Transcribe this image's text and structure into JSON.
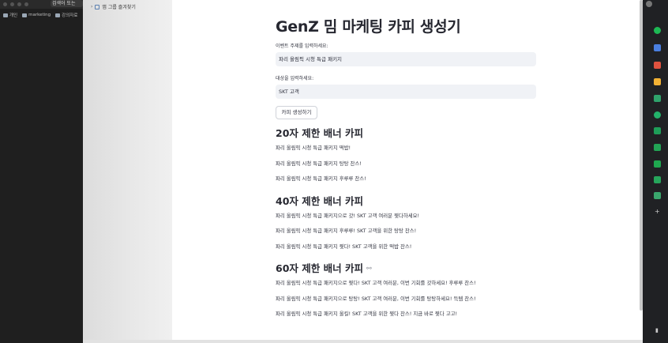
{
  "browser": {
    "search_label": "검색어 또는",
    "bookmarks": [
      "개인",
      "marketing",
      "강의자료"
    ]
  },
  "sidebar": {
    "link_label": "앱 그룹 즐겨찾기"
  },
  "app": {
    "title": "GenZ 밈 마케팅 카피 생성기",
    "event_label": "이벤트 주제를 입력하세요:",
    "event_value": "파리 올림픽 시청 특급 패키지",
    "target_label": "대상을 입력하세요:",
    "target_value": "SKT 고객",
    "generate_button": "카피 생성하기"
  },
  "sections": [
    {
      "heading": "20자 제한 배너 카피",
      "lines": [
        "파리 올림픽 시청 특급 패키지 떡밥!",
        "파리 올림픽 시청 특급 패키지 탕탕 찬스!",
        "파리 올림픽 시청 특급 패키지 후루루 찬스!"
      ]
    },
    {
      "heading": "40자 제한 배너 카피",
      "lines": [
        "파리 올림픽 시청 특급 패키지으로 갓! SKT 고객 여러분 찢다하세요!",
        "파리 올림픽 시청 특급 패키지 후루루! SKT 고객을 위한 탕탕 찬스!",
        "파리 올림픽 시청 특급 패키지 찢다! SKT 고객을 위한 떡밥 찬스!"
      ]
    },
    {
      "heading": "60자 제한 배너 카피",
      "lines": [
        "파리 올림픽 시청 특급 패키지으로 찢다! SKT 고객 여러분, 이번 기회를 갓하세요! 후루루 찬스!",
        "파리 올림픽 시청 특급 패키지으로 탕탕! SKT 고객 여러분, 이번 기회를 탕탕하세요! 득템 찬스!",
        "파리 올림픽 시청 특급 패키지 올킬! SKT 고객을 위한 찢다 찬스! 지금 바로 찢다 고고!"
      ]
    }
  ],
  "icons": {
    "anchor": "link-icon",
    "right_panel": [
      "chrome-green",
      "blue-square",
      "red-square",
      "yellow-square",
      "green-puzzle",
      "green-circle",
      "green-chat",
      "green-sheet",
      "green-play",
      "green-mail",
      "green-photo"
    ]
  },
  "colors": {
    "input_bg": "#f0f2f6",
    "text": "#31333f",
    "heading": "#262730",
    "panel_bg": "#202124"
  }
}
